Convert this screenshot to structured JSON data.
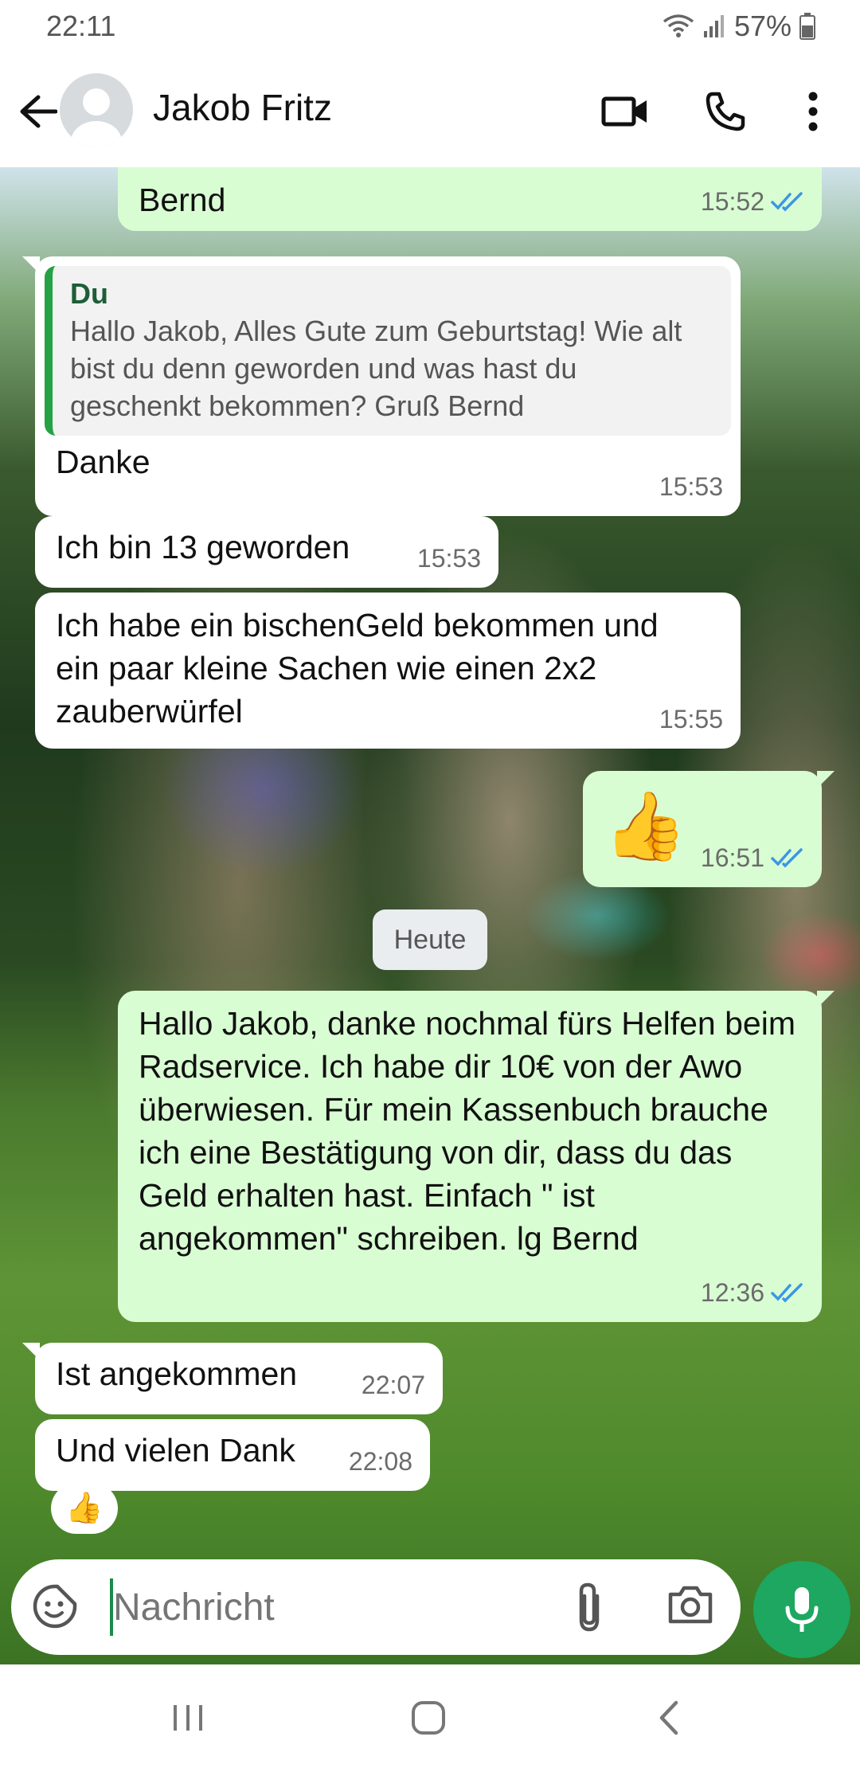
{
  "status_bar": {
    "time": "22:11",
    "battery": "57%"
  },
  "header": {
    "contact_name": "Jakob Fritz"
  },
  "messages": [
    {
      "dir": "out",
      "text": "Bernd",
      "time": "15:52",
      "read": true
    },
    {
      "dir": "in",
      "quote_author": "Du",
      "quote_text": "Hallo Jakob, Alles Gute zum Geburtstag! Wie alt bist du denn geworden und was hast du geschenkt bekommen? Gruß Bernd",
      "text": "Danke",
      "time": "15:53"
    },
    {
      "dir": "in",
      "text": "Ich bin 13 geworden",
      "time": "15:53"
    },
    {
      "dir": "in",
      "text": "Ich habe ein bischenGeld bekommen und ein paar kleine Sachen wie einen 2x2 zauberwürfel",
      "time": "15:55"
    },
    {
      "dir": "out",
      "text": "👍",
      "time": "16:51",
      "read": true
    },
    {
      "dir": "out",
      "text": "Hallo Jakob, danke nochmal fürs Helfen beim Radservice. Ich habe dir 10€ von der Awo überwiesen. Für mein Kassenbuch brauche ich eine Bestätigung von dir, dass du das Geld erhalten hast. Einfach \" ist angekommen\" schreiben. lg Bernd",
      "time": "12:36",
      "read": true
    },
    {
      "dir": "in",
      "text": "Ist angekommen",
      "time": "22:07"
    },
    {
      "dir": "in",
      "text": "Und vielen Dank",
      "time": "22:08",
      "reaction": "👍"
    }
  ],
  "day_separator": "Heute",
  "composer": {
    "placeholder": "Nachricht"
  },
  "colors": {
    "outgoing_bubble": "#d9fdd3",
    "incoming_bubble": "#ffffff",
    "accent": "#1da760",
    "read_ticks": "#3b97e6"
  }
}
